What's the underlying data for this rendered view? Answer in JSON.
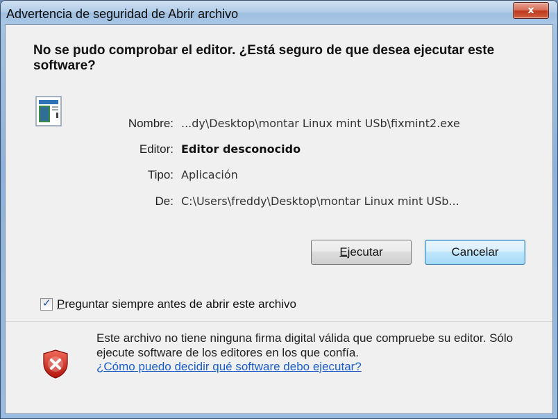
{
  "window": {
    "title": "Advertencia de seguridad de Abrir archivo",
    "close_label": "x"
  },
  "heading": "No se pudo comprobar el editor. ¿Está seguro de que desea ejecutar este software?",
  "file_icon": "application-file-icon",
  "details": [
    {
      "label": "Nombre:",
      "value": "...dy\\Desktop\\montar Linux mint USb\\fixmint2.exe"
    },
    {
      "label": "Editor:",
      "value": "Editor desconocido"
    },
    {
      "label": "Tipo:",
      "value": "Aplicación"
    },
    {
      "label": "De:",
      "value": "C:\\Users\\freddy\\Desktop\\montar Linux mint USb..."
    }
  ],
  "buttons": {
    "run_label_accel": "E",
    "run_label_rest": "jecutar",
    "cancel_label": "Cancelar"
  },
  "checkbox": {
    "checked": true,
    "label_accel": "P",
    "label_rest": "reguntar siempre antes de abrir este archivo"
  },
  "warning": {
    "icon": "security-shield-error-icon",
    "text": "Este archivo no tiene ninguna firma digital válida que compruebe su editor. Sólo ejecute software de los editores en los que confía.",
    "link": "¿Cómo puedo decidir qué software debo ejecutar?"
  },
  "colors": {
    "link": "#1a5fc7",
    "default_button": "#bee6fd",
    "close_button": "#c0391f"
  }
}
